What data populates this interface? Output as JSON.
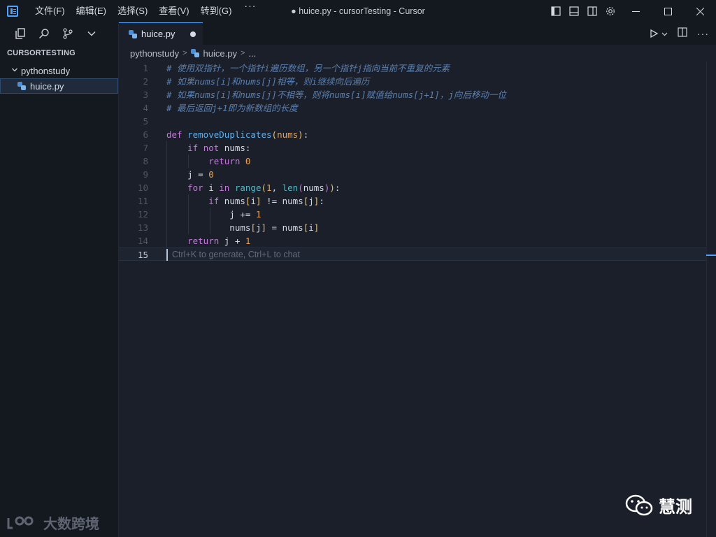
{
  "menu": [
    {
      "label": "文件(F)"
    },
    {
      "label": "编辑(E)"
    },
    {
      "label": "选择(S)"
    },
    {
      "label": "查看(V)"
    },
    {
      "label": "转到(G)"
    }
  ],
  "menu_more": "···",
  "window_title": "● huice.py - cursorTesting - Cursor",
  "sidebar": {
    "section_title": "CURSORTESTING",
    "folder": "pythonstudy",
    "file": "huice.py"
  },
  "tab": {
    "label": "huice.py",
    "modified": true
  },
  "breadcrumb": [
    "pythonstudy",
    "huice.py",
    "..."
  ],
  "editor": {
    "lines": [
      {
        "n": "1",
        "text": "# 使用双指针，一个指针i遍历数组，另一个指针j指向当前不重复的元素"
      },
      {
        "n": "2",
        "text": "# 如果nums[i]和nums[j]相等，则i继续向后遍历"
      },
      {
        "n": "3",
        "text": "# 如果nums[i]和nums[j]不相等，则将nums[i]赋值给nums[j+1]，j向后移动一位"
      },
      {
        "n": "4",
        "text": "# 最后返回j+1即为新数组的长度"
      },
      {
        "n": "5",
        "text": ""
      },
      {
        "n": "6",
        "text": "def removeDuplicates(nums):"
      },
      {
        "n": "7",
        "text": "    if not nums:"
      },
      {
        "n": "8",
        "text": "        return 0"
      },
      {
        "n": "9",
        "text": "    j = 0"
      },
      {
        "n": "10",
        "text": "    for i in range(1, len(nums)):"
      },
      {
        "n": "11",
        "text": "        if nums[i] != nums[j]:"
      },
      {
        "n": "12",
        "text": "            j += 1"
      },
      {
        "n": "13",
        "text": "            nums[j] = nums[i]"
      },
      {
        "n": "14",
        "text": "    return j + 1"
      },
      {
        "n": "15",
        "text": ""
      }
    ],
    "active_line": "15",
    "hint": "Ctrl+K to generate, Ctrl+L to chat"
  },
  "watermarks": {
    "left": "大数跨境",
    "right": "慧测"
  },
  "colors": {
    "accent": "#4da3ff",
    "comment": "#5b7fb0",
    "keyword": "#c678dd",
    "function": "#61afef",
    "number": "#e5a35c",
    "builtin": "#56b6c2"
  }
}
